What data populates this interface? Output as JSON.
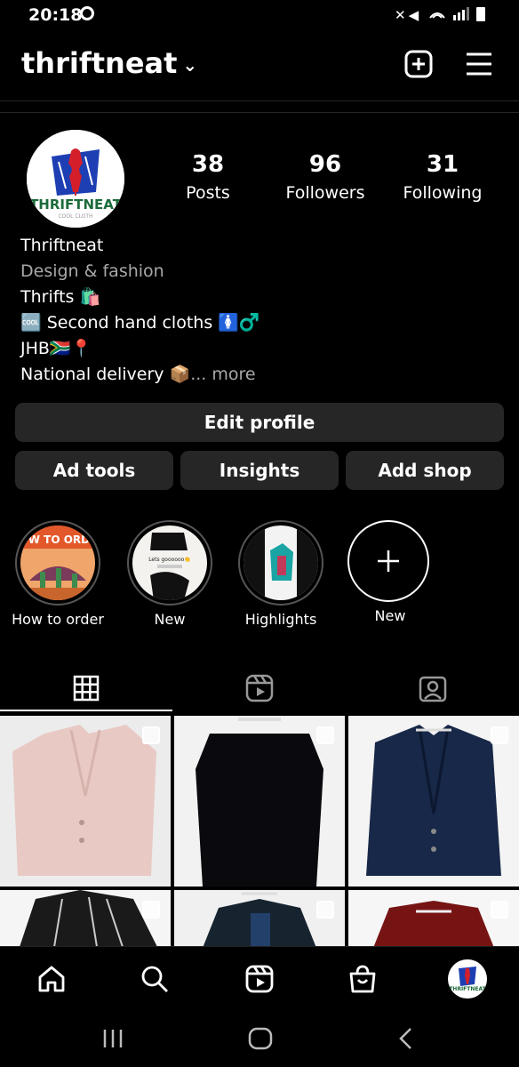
{
  "status": {
    "time": "20:18",
    "icons": " "
  },
  "header": {
    "username": "thriftneat",
    "chevron": "⌄"
  },
  "avatar": {
    "brand": "THRIFTNEAT",
    "tagline": "COOL CLOTH"
  },
  "stats": [
    {
      "value": "38",
      "label": "Posts"
    },
    {
      "value": "96",
      "label": "Followers"
    },
    {
      "value": "31",
      "label": "Following"
    }
  ],
  "bio": {
    "name": "Thriftneat",
    "category": "Design & fashion",
    "line1": "Thrifts 🛍️",
    "line2": "🆒 Second hand cloths 🚺♂️",
    "line3": "JHB🇿🇦📍",
    "line4": "National delivery 📦",
    "more": "... more"
  },
  "buttons": {
    "edit_profile": "Edit profile",
    "ad_tools": "Ad tools",
    "insights": "Insights",
    "add_shop": "Add shop"
  },
  "highlights": [
    {
      "label": "How to order",
      "cover_text": "HOW TO ORDER"
    },
    {
      "label": "New",
      "cover_text": "Lets goooooo👏"
    },
    {
      "label": "Highlights"
    },
    {
      "label": "New"
    }
  ],
  "tabs": [
    "grid-icon",
    "reels-icon",
    "tagged-icon"
  ],
  "grid_colors": [
    "#e9c9c6",
    "#0c0c10",
    "#1a2a52",
    "#181818",
    "#1b2733",
    "#7a1515"
  ],
  "bottom_nav": [
    "home-icon",
    "search-icon",
    "reels-icon",
    "shop-icon",
    "profile-avatar"
  ],
  "avatar_mini": "THRIFTNEAT"
}
